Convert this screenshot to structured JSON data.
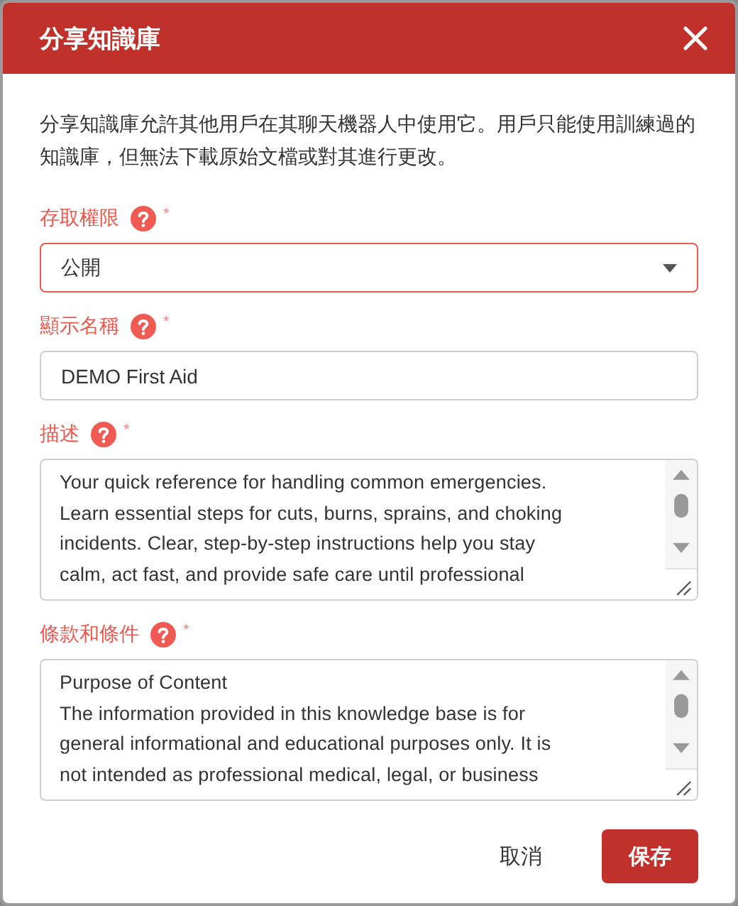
{
  "dialog": {
    "title": "分享知識庫",
    "description": "分享知識庫允許其他用戶在其聊天機器人中使用它。用戶只能使用訓練過的知識庫，但無法下載原始文檔或對其進行更改。",
    "fields": [
      {
        "kind": "select",
        "label": "存取權限",
        "required_mark": "*",
        "value": "公開",
        "focused": true
      },
      {
        "kind": "input",
        "label": "顯示名稱",
        "required_mark": "*",
        "value": "DEMO First Aid",
        "focused": false
      },
      {
        "kind": "textarea",
        "label": "描述",
        "required_mark": "*",
        "value_lines": [
          "Your quick reference for handling common emergencies.",
          "Learn essential steps for cuts, burns, sprains, and choking",
          "incidents. Clear, step-by-step instructions help you stay",
          "calm, act fast, and provide safe care until professional"
        ],
        "focused": false
      },
      {
        "kind": "textarea",
        "label": "條款和條件",
        "required_mark": "*",
        "value_lines": [
          "Purpose of Content",
          "The information provided in this knowledge base is for",
          "general informational and educational purposes only. It is",
          "not intended as professional medical, legal, or business"
        ],
        "focused": false
      }
    ],
    "buttons": [
      {
        "label": "取消",
        "kind": "secondary"
      },
      {
        "label": "保存",
        "kind": "primary"
      }
    ]
  }
}
